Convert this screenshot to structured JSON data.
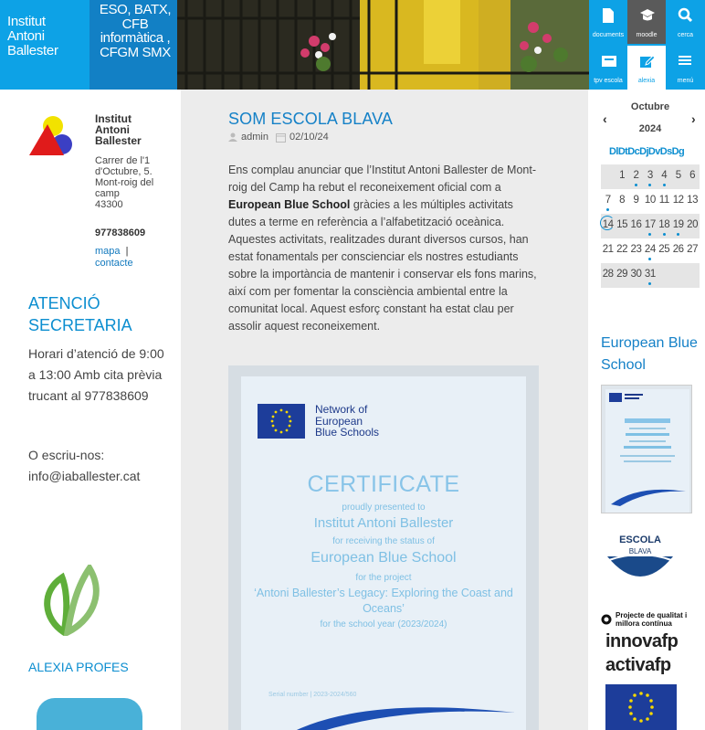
{
  "header": {
    "brand_lines": [
      "Institut",
      "Antoni",
      "Ballester"
    ],
    "studies_lines": [
      "ESO, BATX,",
      "CFB",
      "informàtica ,",
      "CFGM SMX"
    ],
    "nav": [
      {
        "label": "documents",
        "icon": "document-icon"
      },
      {
        "label": "moodle",
        "icon": "graduation-cap-icon"
      },
      {
        "label": "cerca",
        "icon": "search-icon"
      },
      {
        "label": "tpv escola",
        "icon": "tpv-icon"
      },
      {
        "label": "alexia",
        "icon": "edit-icon"
      },
      {
        "label": "menú",
        "icon": "menu-icon"
      }
    ]
  },
  "left": {
    "school_name": [
      "Institut",
      "Antoni",
      "Ballester"
    ],
    "address": [
      "Carrer de l'1",
      "d'Octubre, 5.",
      "Mont-roig del",
      "camp",
      "43300"
    ],
    "phone": "977838609",
    "link_map": "mapa",
    "link_sep": "|",
    "link_contact": "contacte",
    "attention_title": "ATENCIÓ SECRETARIA",
    "attention_text": "Horari d’atenció de 9:00 a 13:00 Amb cita prèvia trucant al 977838609",
    "write_text": "O escriu-nos: info@iaballester.cat",
    "alexia_profes": "ALEXIA PROFES"
  },
  "post": {
    "title": "SOM ESCOLA BLAVA",
    "author": "admin",
    "date": "02/10/24",
    "body_before": "Ens complau anunciar que l’Institut Antoni Ballester de Mont-roig del Camp ha rebut el reconeixement oficial com a ",
    "body_bold": "European Blue School",
    "body_after": " gràcies a les múltiples activitats dutes a terme en referència a l’alfabetització oceànica. Aquestes activitats, realitzades durant diversos cursos, han estat fonamentals per conscienciar els nostres estudiants sobre la importància de mantenir i conservar els fons marins, així com per fomentar la consciència ambiental entre la comunitat local. Aquest esforç constant ha estat clau per assolir aquest reconeixement."
  },
  "certificate": {
    "network": [
      "Network of",
      "European",
      "Blue Schools"
    ],
    "title": "CERTIFICATE",
    "presented": "proudly presented to",
    "school": "Institut Antoni Ballester",
    "receiving": "for receiving the status of",
    "status": "European Blue School",
    "for_project": "for the project",
    "project": "‘Antoni Ballester’s Legacy: Exploring the Coast and Oceans’",
    "year": "for the school year (2023/2024)",
    "serial": "Serial number | 2023-2024/560"
  },
  "calendar": {
    "month": "Octubre",
    "year": "2024",
    "prev": "‹",
    "next": "›",
    "weekdays": [
      "Dl",
      "Dt",
      "Dc",
      "Dj",
      "Dv",
      "Ds",
      "Dg"
    ],
    "weeks": [
      [
        "",
        "1",
        "2",
        "3",
        "4",
        "5",
        "6"
      ],
      [
        "7",
        "8",
        "9",
        "10",
        "11",
        "12",
        "13"
      ],
      [
        "14",
        "15",
        "16",
        "17",
        "18",
        "19",
        "20"
      ],
      [
        "21",
        "22",
        "23",
        "24",
        "25",
        "26",
        "27"
      ],
      [
        "28",
        "29",
        "30",
        "31",
        "",
        "",
        ""
      ]
    ],
    "event_days": [
      "2",
      "3",
      "4",
      "7",
      "17",
      "18",
      "19",
      "24",
      "31"
    ],
    "today": "14"
  },
  "right": {
    "ebs_title": "European Blue School",
    "escola_lines": [
      "ESCOLA",
      "BLAVA"
    ],
    "qualitat": "Projecte de qualitat i millora contínua",
    "innova": "innovafp",
    "activa": "activafp"
  },
  "colors": {
    "brand": "#0da2e6",
    "studies": "#1280c5",
    "accent": "#0c8ed0",
    "main_bg": "#ececec"
  }
}
